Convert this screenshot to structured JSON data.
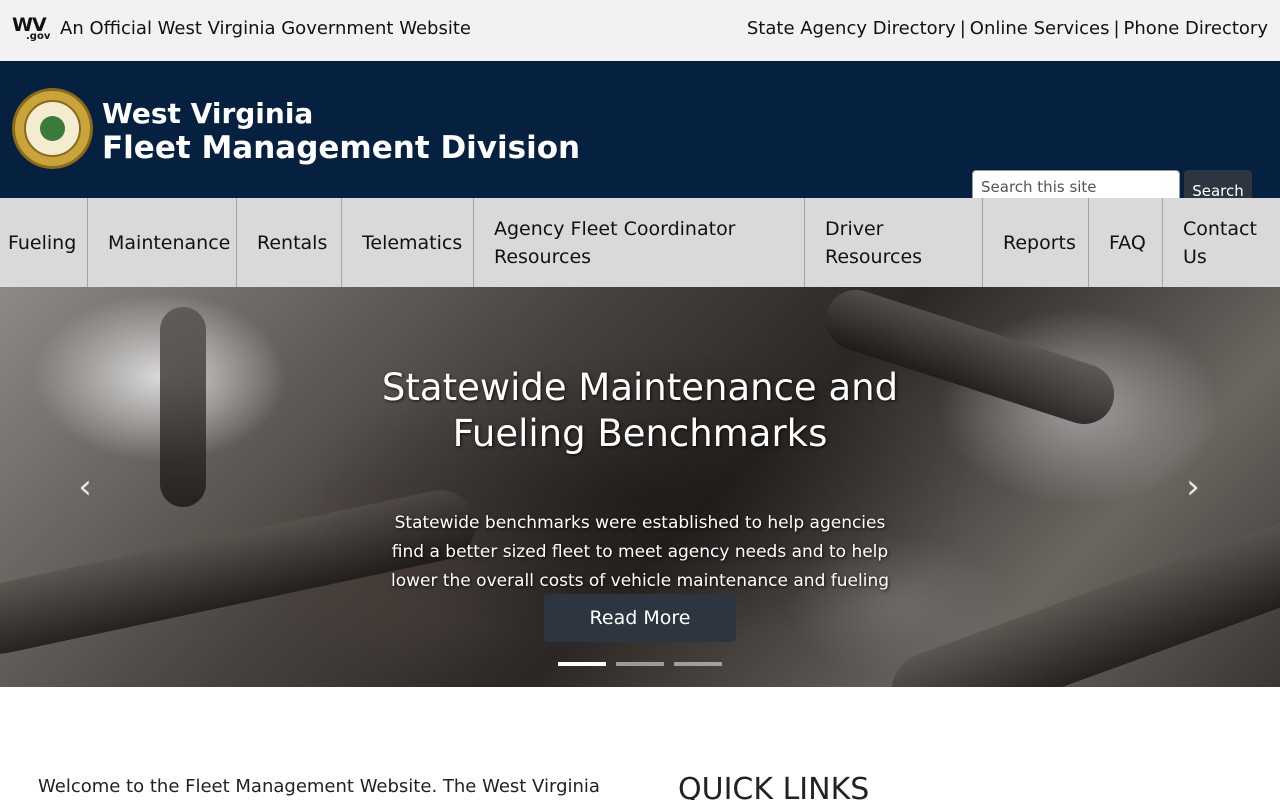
{
  "topbar": {
    "logo_text": "WV",
    "logo_sub": ".gov",
    "official_text": "An Official West Virginia Government Website",
    "links": [
      {
        "label": "State Agency Directory"
      },
      {
        "label": "Online Services"
      },
      {
        "label": "Phone Directory"
      }
    ],
    "separator": "|"
  },
  "header": {
    "title_line1": "West Virginia",
    "title_line2": "Fleet Management Division",
    "search": {
      "placeholder": "Search this site",
      "button_label": "Search"
    }
  },
  "nav": {
    "items": [
      {
        "label": "Fueling"
      },
      {
        "label": "Maintenance"
      },
      {
        "label": "Rentals"
      },
      {
        "label": "Telematics"
      },
      {
        "label": "Agency Fleet Coordinator Resources"
      },
      {
        "label": "Driver Resources"
      },
      {
        "label": "Reports"
      },
      {
        "label": "FAQ"
      },
      {
        "label": "Contact Us"
      }
    ]
  },
  "hero": {
    "title": "Statewide Maintenance and Fueling Benchmarks",
    "text": "Statewide benchmarks were established to help agencies find a better sized fleet to meet agency needs and to help lower the overall costs of vehicle maintenance and fueling",
    "button_label": "Read More",
    "prev_icon": "‹",
    "next_icon": "›",
    "slide_count": 3,
    "active_slide": 1
  },
  "content": {
    "welcome_text": "Welcome to the Fleet Management Website.  The West Virginia",
    "quick_links_heading": "QUICK LINKS"
  }
}
